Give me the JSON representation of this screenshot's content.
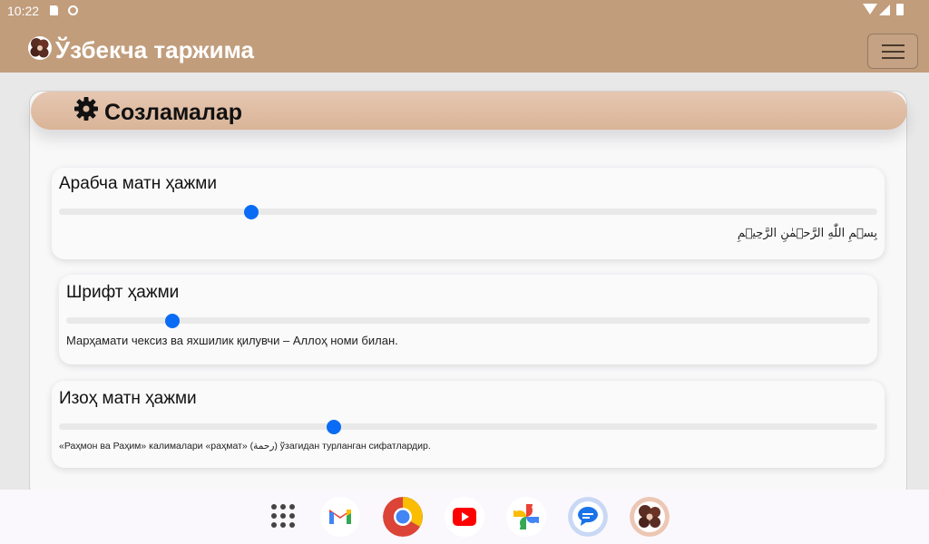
{
  "status_bar": {
    "time": "10:22"
  },
  "app_bar": {
    "title": "Ўзбекча таржима",
    "menu_icon": "hamburger-menu-icon"
  },
  "settings": {
    "title": "Созламалар",
    "arabic_size": {
      "label": "Арабча матн ҳажми",
      "value_fraction": 0.235,
      "sample": "بِسۡمِ اللّٰهِ الرَّحۡمٰنِ الرَّحِیۡمِ"
    },
    "font_size": {
      "label": "Шрифт ҳажми",
      "value_fraction": 0.133,
      "sample": "Марҳамати чексиз ва яхшилик қилувчи – Аллоҳ номи билан."
    },
    "comment_size": {
      "label": "Изоҳ матн ҳажми",
      "value_fraction": 0.335,
      "sample": "«Раҳмон ва Раҳим» калималари «раҳмат» (رحمة) ўзагидан турланган сифатлардир."
    }
  },
  "taskbar": {
    "apps": [
      "apps-grid-icon",
      "gmail-icon",
      "chrome-icon",
      "youtube-icon",
      "photos-icon",
      "messages-icon",
      "app-logo-icon"
    ]
  },
  "colors": {
    "app_bar": "#c19d7c",
    "header_gradient": "#dcb89c",
    "slider_thumb": "#0a6cf4"
  }
}
